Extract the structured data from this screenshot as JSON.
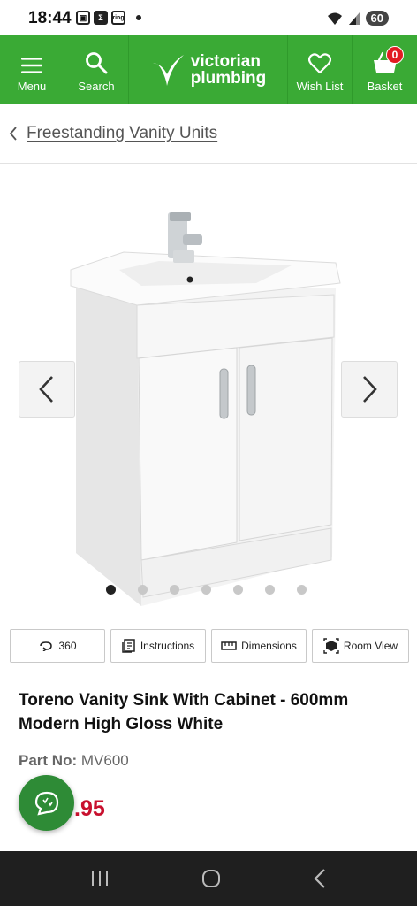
{
  "status_bar": {
    "time": "18:44",
    "icon_ring": "ring",
    "icon_sigma": "Σ",
    "battery": "60"
  },
  "header": {
    "menu_label": "Menu",
    "search_label": "Search",
    "logo_line1": "victorian",
    "logo_line2": "plumbing",
    "wishlist_label": "Wish List",
    "basket_label": "Basket",
    "basket_count": "0",
    "brand_color": "#3aaa35"
  },
  "breadcrumb": {
    "link": "Freestanding Vanity Units"
  },
  "gallery": {
    "slide_count": 7,
    "active_index": 0
  },
  "features": {
    "view360": "360",
    "instructions": "Instructions",
    "dimensions": "Dimensions",
    "room_view": "Room View"
  },
  "product": {
    "title": "Toreno Vanity Sink With Cabinet - 600mm Modern High Gloss White",
    "part_label": "Part No:",
    "part_number": "MV600",
    "price_visible": ".95",
    "price_color": "#c8102e"
  }
}
